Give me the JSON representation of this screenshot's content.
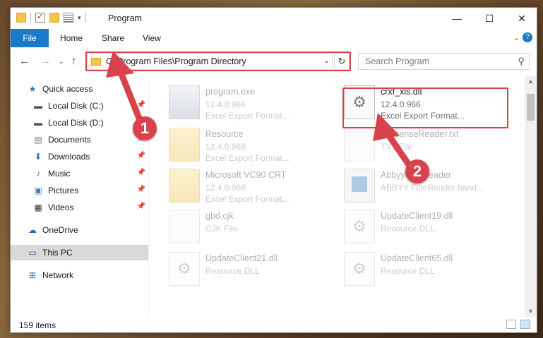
{
  "window": {
    "title": "Program"
  },
  "ribbon": {
    "tabs": [
      "File",
      "Home",
      "Share",
      "View"
    ]
  },
  "address": {
    "path": "C:\\Program Files\\Program Directory"
  },
  "search": {
    "placeholder": "Search Program"
  },
  "sidebar": {
    "items": [
      {
        "label": "Quick access",
        "icon": "star-icon"
      },
      {
        "label": "Local Disk (C:)",
        "icon": "drive-icon",
        "pinned": true
      },
      {
        "label": "Local Disk (D:)",
        "icon": "drive-icon"
      },
      {
        "label": "Documents",
        "icon": "documents-icon",
        "pinned": true
      },
      {
        "label": "Downloads",
        "icon": "download-icon",
        "pinned": true
      },
      {
        "label": "Music",
        "icon": "music-icon",
        "pinned": true
      },
      {
        "label": "Pictures",
        "icon": "pictures-icon",
        "pinned": true
      },
      {
        "label": "Videos",
        "icon": "videos-icon",
        "pinned": true
      },
      {
        "label": "OneDrive",
        "icon": "cloud-icon"
      },
      {
        "label": "This PC",
        "icon": "computer-icon",
        "selected": true
      },
      {
        "label": "Network",
        "icon": "network-icon"
      }
    ]
  },
  "files": [
    {
      "name": "program.exe",
      "version": "12.4.0.966",
      "desc": "Excel Export Format...",
      "type": "exe"
    },
    {
      "name": "crxf_xls.dll",
      "version": "12.4.0.966",
      "desc": "Excel Export Format...",
      "type": "dll",
      "highlighted": true
    },
    {
      "name": "Resource",
      "version": "12.4.0.966",
      "desc": "Excel Export Format...",
      "type": "folder"
    },
    {
      "name": "hexsenseReader.txt",
      "version": "TXT File",
      "desc": "",
      "type": "doc"
    },
    {
      "name": "Microsoft VC90 CRT",
      "version": "12.4.0.966",
      "desc": "Excel Export Format...",
      "type": "folder"
    },
    {
      "name": "AbbyyFineReader",
      "version": "ABBYY FineReader hand...",
      "desc": "",
      "type": "app"
    },
    {
      "name": "gbd.cjk",
      "version": "CJK File",
      "desc": "",
      "type": "doc"
    },
    {
      "name": "UpdateClient19.dll",
      "version": "Resource DLL",
      "desc": "",
      "type": "dll"
    },
    {
      "name": "UpdateClient21.dll",
      "version": "Resource DLL",
      "desc": "",
      "type": "dll"
    },
    {
      "name": "UpdateClient65.dll",
      "version": "Resource DLL",
      "desc": "",
      "type": "dll"
    }
  ],
  "status": {
    "item_count": "159 items"
  },
  "callouts": [
    "1",
    "2"
  ],
  "colors": {
    "accent": "#1979ca",
    "highlight": "#d9424a"
  }
}
